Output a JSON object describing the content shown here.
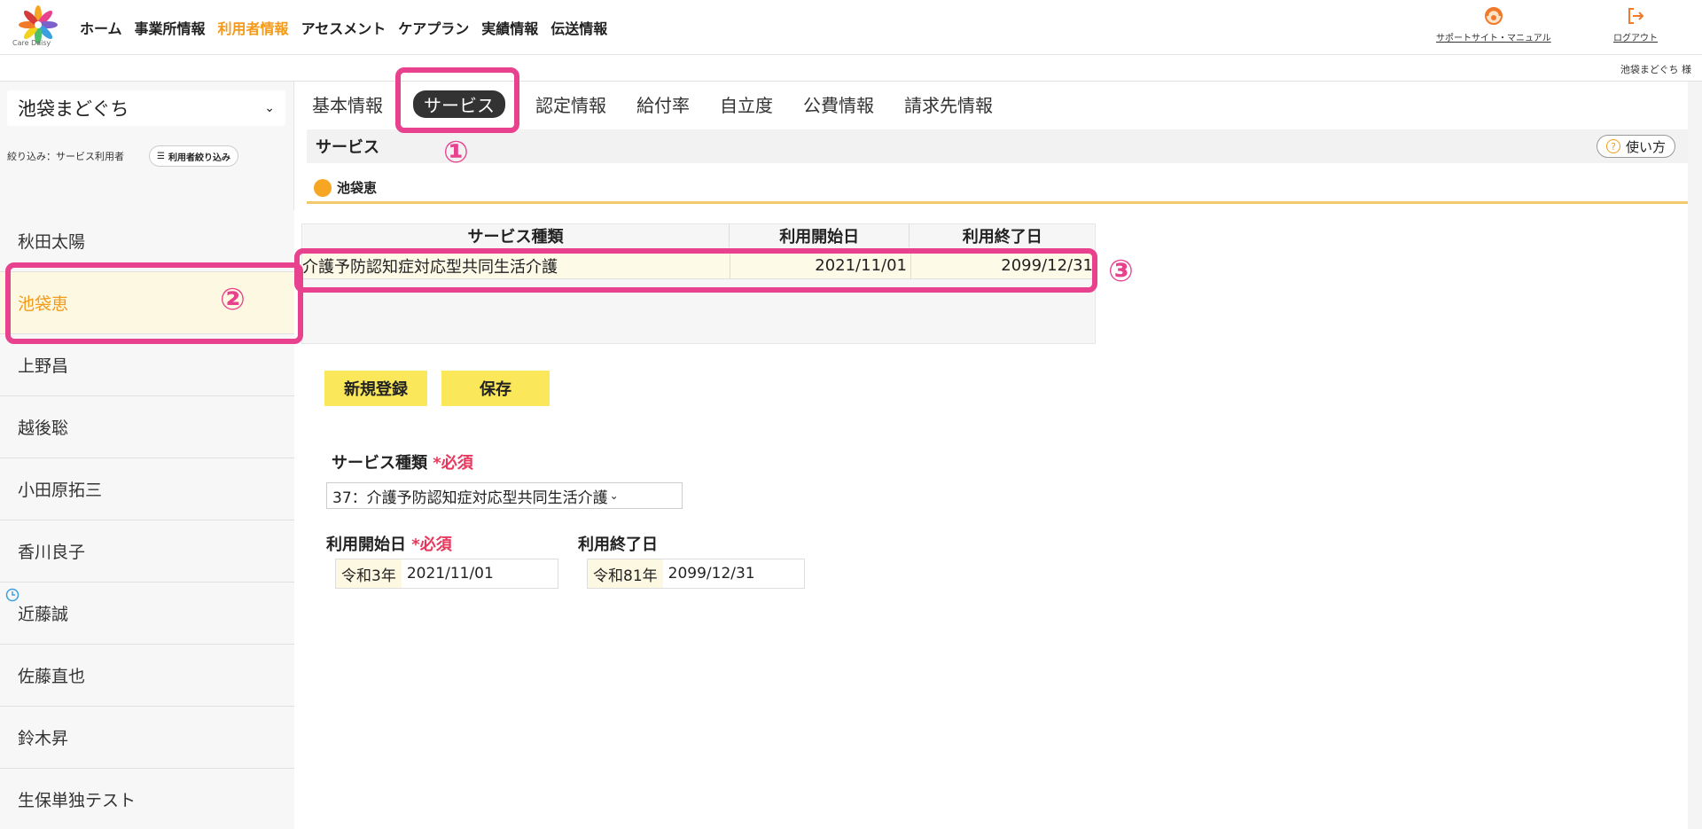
{
  "brand": {
    "logo_text": "Care Daisy"
  },
  "nav": [
    {
      "label": "ホーム"
    },
    {
      "label": "事業所情報"
    },
    {
      "label": "利用者情報"
    },
    {
      "label": "アセスメント"
    },
    {
      "label": "ケアプラン"
    },
    {
      "label": "実績情報"
    },
    {
      "label": "伝送情報"
    }
  ],
  "header_links": {
    "support": "サポートサイト・マニュアル",
    "logout": "ログアウト"
  },
  "current_user_label": "池袋まどぐち 様",
  "sidebar": {
    "facility": "池袋まどぐち",
    "filter_label": "絞り込み：サービス利用者",
    "filter_button": "利用者絞り込み",
    "users": [
      "秋田太陽",
      "池袋恵",
      "上野昌",
      "越後聡",
      "小田原拓三",
      "香川良子",
      "近藤誠",
      "佐藤直也",
      "鈴木昇",
      "生保単独テスト"
    ]
  },
  "tabs": [
    {
      "label": "基本情報"
    },
    {
      "label": "サービス"
    },
    {
      "label": "認定情報"
    },
    {
      "label": "給付率"
    },
    {
      "label": "自立度"
    },
    {
      "label": "公費情報"
    },
    {
      "label": "請求先情報"
    }
  ],
  "section": {
    "title": "サービス",
    "help": "使い方"
  },
  "selected_user": "池袋恵",
  "service_table": {
    "headers": [
      "サービス種類",
      "利用開始日",
      "利用終了日"
    ],
    "rows": [
      {
        "type": "介護予防認知症対応型共同生活介護",
        "start": "2021/11/01",
        "end": "2099/12/31"
      }
    ]
  },
  "buttons": {
    "new": "新規登録",
    "save": "保存"
  },
  "form": {
    "service_type_label": "サービス種類",
    "required": "*必須",
    "service_type_value": "37：介護予防認知症対応型共同生活介護",
    "start_label": "利用開始日",
    "end_label": "利用終了日",
    "start_era": "令和3年",
    "start_date": "2021/11/01",
    "end_era": "令和81年",
    "end_date": "2099/12/31"
  },
  "annotations": {
    "m1": "①",
    "m2": "②",
    "m3": "③"
  },
  "colors": {
    "accent": "#f39a1b",
    "highlight": "#e8418e",
    "button": "#fbe85a",
    "required": "#e8375c"
  }
}
